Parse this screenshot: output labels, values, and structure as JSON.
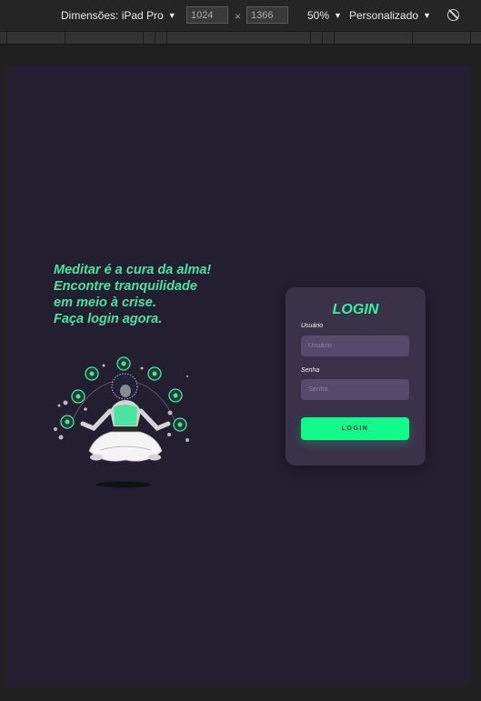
{
  "devtools": {
    "dimensions_label": "Dimensões: iPad Pro",
    "width": "1024",
    "height": "1366",
    "times": "×",
    "zoom": "50%",
    "throttle": "Personalizado"
  },
  "app": {
    "tagline": [
      "Meditar é a cura da alma!",
      "Encontre tranquilidade",
      "em meio à crise.",
      "Faça login agora."
    ],
    "login": {
      "title": "LOGIN",
      "username_label": "Usuário",
      "username_placeholder": "Usuário",
      "password_label": "Senha",
      "password_placeholder": "Senha",
      "button": "LOGIN"
    },
    "colors": {
      "accent": "#12fb8a",
      "accent_text": "#4be3a0",
      "background": "#231f31",
      "card": "#3a3249",
      "input": "#554a6c"
    }
  }
}
